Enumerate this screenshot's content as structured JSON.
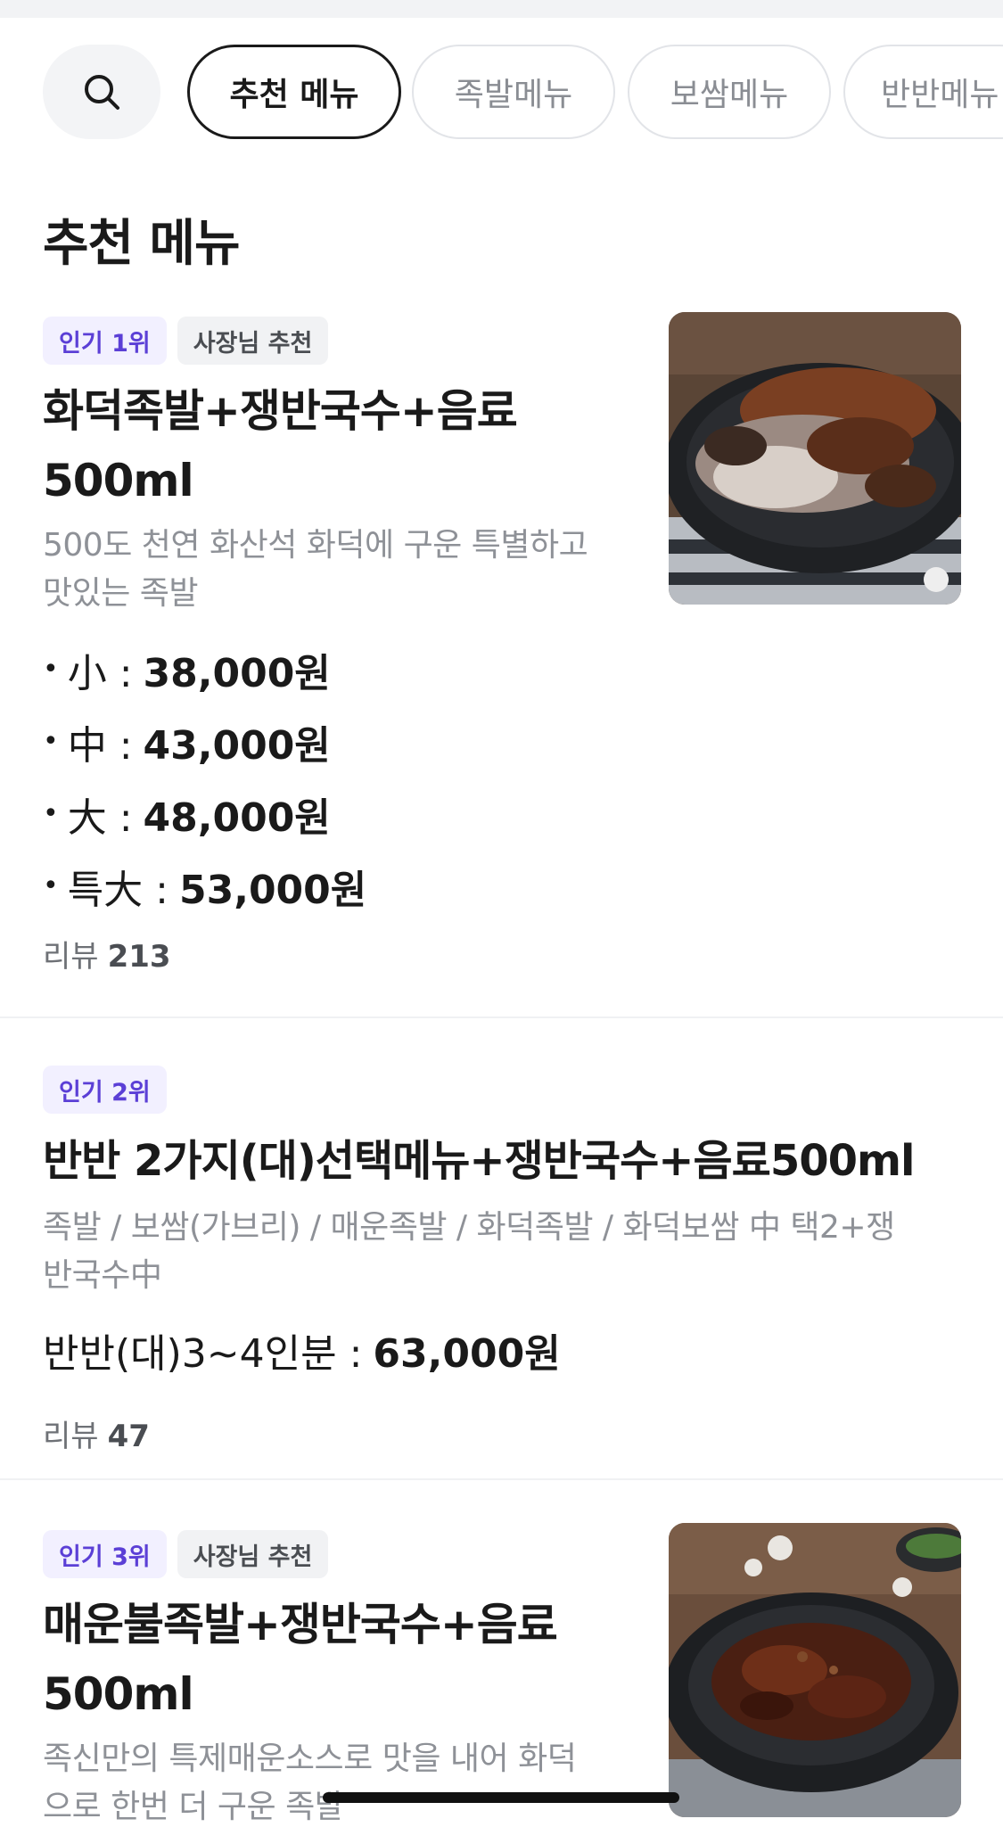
{
  "tabs": {
    "items": [
      {
        "label": "추천 메뉴",
        "active": true
      },
      {
        "label": "족발메뉴",
        "active": false
      },
      {
        "label": "보쌈메뉴",
        "active": false
      },
      {
        "label": "반반메뉴",
        "active": false
      }
    ]
  },
  "section": {
    "title": "추천 메뉴"
  },
  "menu": [
    {
      "badges": [
        "인기 1위",
        "사장님 추천"
      ],
      "name_line1": "화덕족발+쟁반국수+음료",
      "name_line2": "500ml",
      "desc_line1": "500도 천연 화산석 화덕에 구운 특별하고",
      "desc_line2": "맛있는 족발",
      "prices": [
        {
          "bullet": "•",
          "label": "小 :",
          "amount": "38,000원"
        },
        {
          "bullet": "•",
          "label": "中 :",
          "amount": "43,000원"
        },
        {
          "bullet": "•",
          "label": "大 :",
          "amount": "48,000원"
        },
        {
          "bullet": "•",
          "label": "특大 :",
          "amount": "53,000원"
        }
      ],
      "review_label": "리뷰",
      "review_count": "213"
    },
    {
      "badges": [
        "인기 2위"
      ],
      "name_line1": "반반 2가지(대)선택메뉴+쟁반국수+음료500ml",
      "desc_line1": "족발 / 보쌈(가브리) / 매운족발 / 화덕족발 / 화덕보쌈 中 택2+쟁",
      "desc_line2": "반국수中",
      "prices": [
        {
          "label": "반반(대)3~4인분 :",
          "amount": "63,000원"
        }
      ],
      "review_label": "리뷰",
      "review_count": "47"
    },
    {
      "badges": [
        "인기 3위",
        "사장님 추천"
      ],
      "name_line1": "매운불족발+쟁반국수+음료",
      "name_line2": "500ml",
      "desc_line1": "족신만의 특제매운소스로 맛을 내어 화덕",
      "desc_line2": "으로 한번 더 구운 족발"
    }
  ],
  "colors": {
    "accent": "#5b3fd6",
    "rank_badge_bg": "#f2f0ff"
  },
  "icons": {
    "search": "search-icon"
  }
}
